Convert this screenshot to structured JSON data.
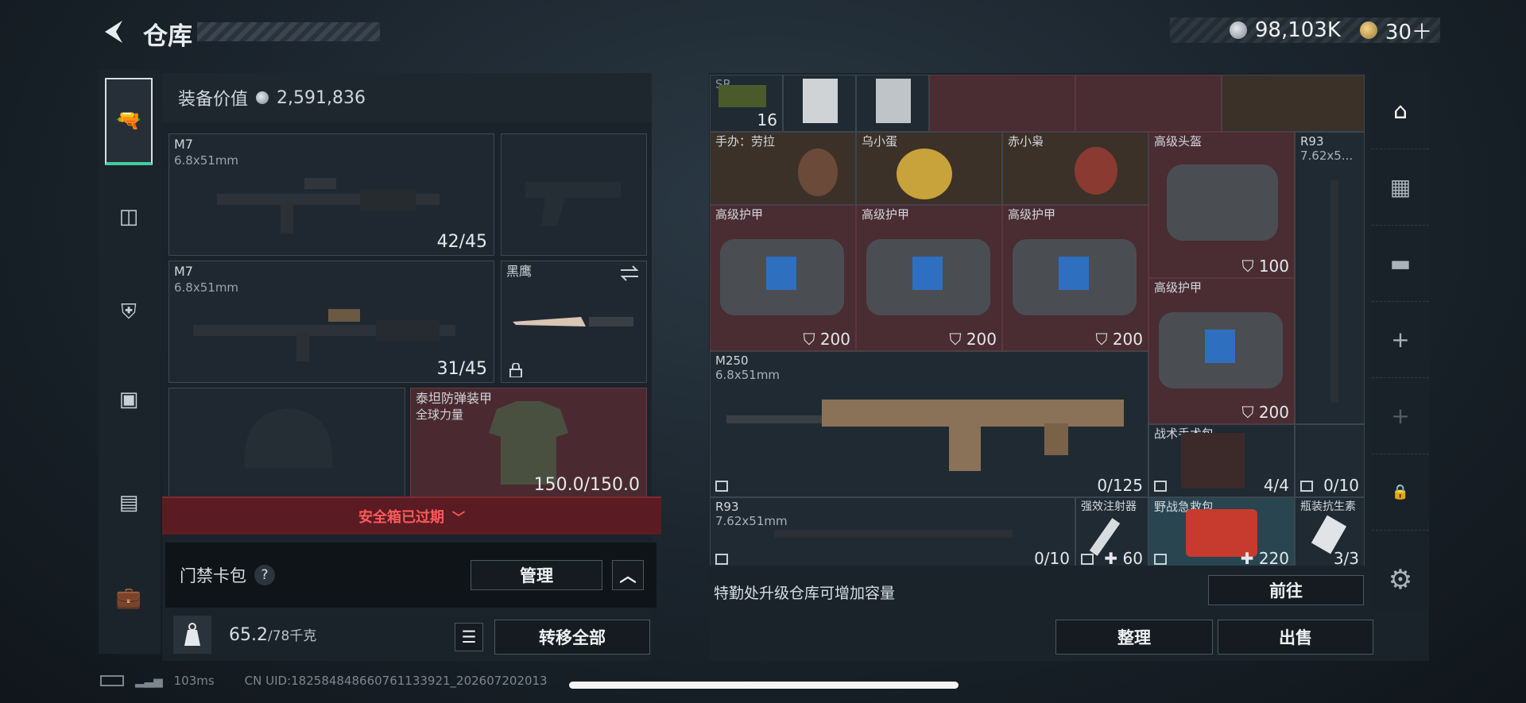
{
  "header": {
    "title": "仓库",
    "currency_silver": "98,103K",
    "currency_gold": "30＋"
  },
  "equipment": {
    "value_label": "装备价值",
    "value": "2,591,836",
    "slots": [
      {
        "name": "M7",
        "sub": "6.8x51mm",
        "count": "42/45"
      },
      {
        "name": "M7",
        "sub": "6.8x51mm",
        "count": "31/45"
      },
      {
        "name": "黑鹰"
      },
      {
        "name": "泰坦防弹装甲",
        "sub": "全球力量",
        "count": "150.0/150.0"
      }
    ],
    "expired_text": "安全箱已过期",
    "keycard_label": "门禁卡包",
    "keycard_help": "?",
    "manage": "管理",
    "weight_current": "65.2",
    "weight_total": "/78千克",
    "transfer_all": "转移全部"
  },
  "storage": {
    "items": [
      {
        "name": "SR",
        "count": "16"
      },
      {
        "name": "手办：劳拉"
      },
      {
        "name": "乌小蛋"
      },
      {
        "name": "赤小枭"
      },
      {
        "name": "高级头盔",
        "count": "100"
      },
      {
        "name": "R93",
        "sub": "7.62x5..."
      },
      {
        "name": "高级护甲",
        "count": "200"
      },
      {
        "name": "高级护甲",
        "count": "200"
      },
      {
        "name": "高级护甲",
        "count": "200"
      },
      {
        "name": "高级护甲",
        "count": "200"
      },
      {
        "name": "M250",
        "sub": "6.8x51mm",
        "count": "0/125"
      },
      {
        "name": "战术手术包",
        "count": "4/4"
      },
      {
        "name": "",
        "count": "0/10"
      },
      {
        "name": "R93",
        "sub": "7.62x51mm",
        "count": "0/10"
      },
      {
        "name": "强效注射器",
        "count": "60"
      },
      {
        "name": "野战急救包",
        "count": "220"
      },
      {
        "name": "瓶装抗生素",
        "count": "3/3"
      }
    ],
    "hint": "特勤处升级仓库可增加容量",
    "goto": "前往",
    "sort": "整理",
    "sell": "出售"
  },
  "status": {
    "ping": "103ms",
    "uid": "CN UID:18258484866076113392​1_20260720​2013"
  },
  "colors": {
    "accent_green": "#3ecf9a",
    "expired_red": "#ff5a5a"
  }
}
